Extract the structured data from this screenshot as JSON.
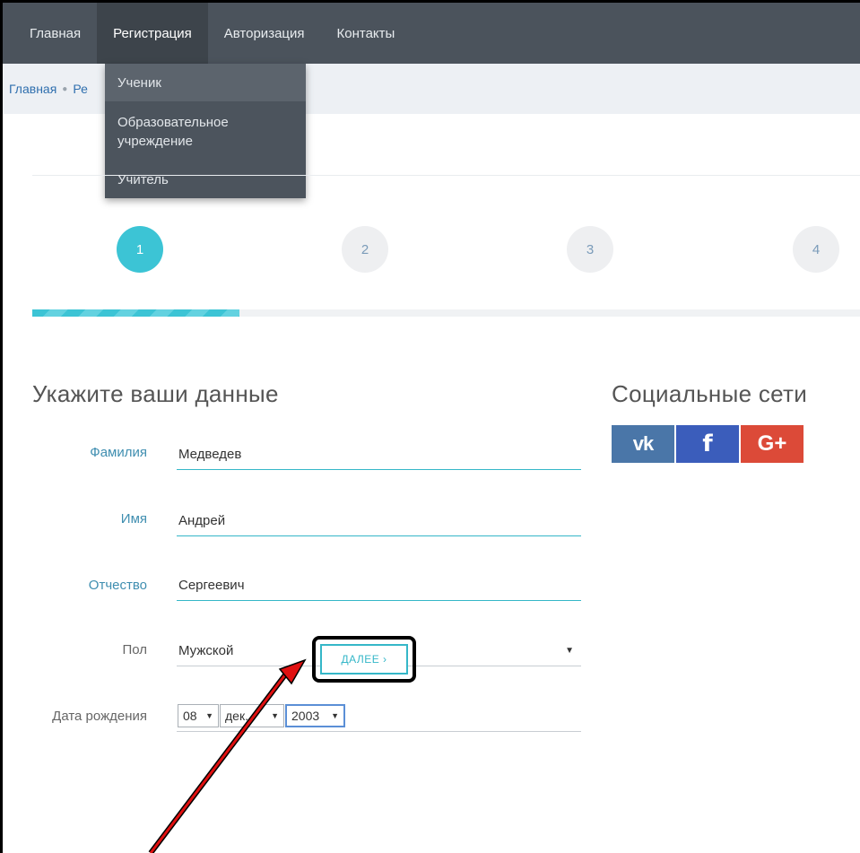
{
  "nav": {
    "items": [
      {
        "label": "Главная"
      },
      {
        "label": "Регистрация"
      },
      {
        "label": "Авторизация"
      },
      {
        "label": "Контакты"
      }
    ]
  },
  "breadcrumb": {
    "home": "Главная",
    "current": "Ре"
  },
  "dropdown": {
    "items": [
      {
        "label": "Ученик"
      },
      {
        "label": "Образовательное учреждение"
      },
      {
        "label": "Учитель"
      }
    ]
  },
  "steps": {
    "items": [
      "1",
      "2",
      "3",
      "4"
    ],
    "active": 1,
    "progress_fraction": 0.25
  },
  "form": {
    "title": "Укажите ваши данные",
    "last_name": {
      "label": "Фамилия",
      "value": "Медведев"
    },
    "first_name": {
      "label": "Имя",
      "value": "Андрей"
    },
    "patronymic": {
      "label": "Отчество",
      "value": "Сергеевич"
    },
    "gender": {
      "label": "Пол",
      "value": "Мужской"
    },
    "birthdate": {
      "label": "Дата рождения",
      "day": "08",
      "month": "дек.",
      "year": "2003"
    },
    "next_label": "ДАЛЕЕ ›"
  },
  "social": {
    "title": "Социальные сети",
    "vk": "vk",
    "fb": "f",
    "gp": "G+"
  },
  "colors": {
    "nav_bg": "#4b535c",
    "accent": "#3cc4d5",
    "link": "#2f6fae",
    "vk": "#4a76a8",
    "facebook": "#3b5dbb",
    "google": "#dc4a38",
    "annotation_arrow": "#e01010"
  }
}
